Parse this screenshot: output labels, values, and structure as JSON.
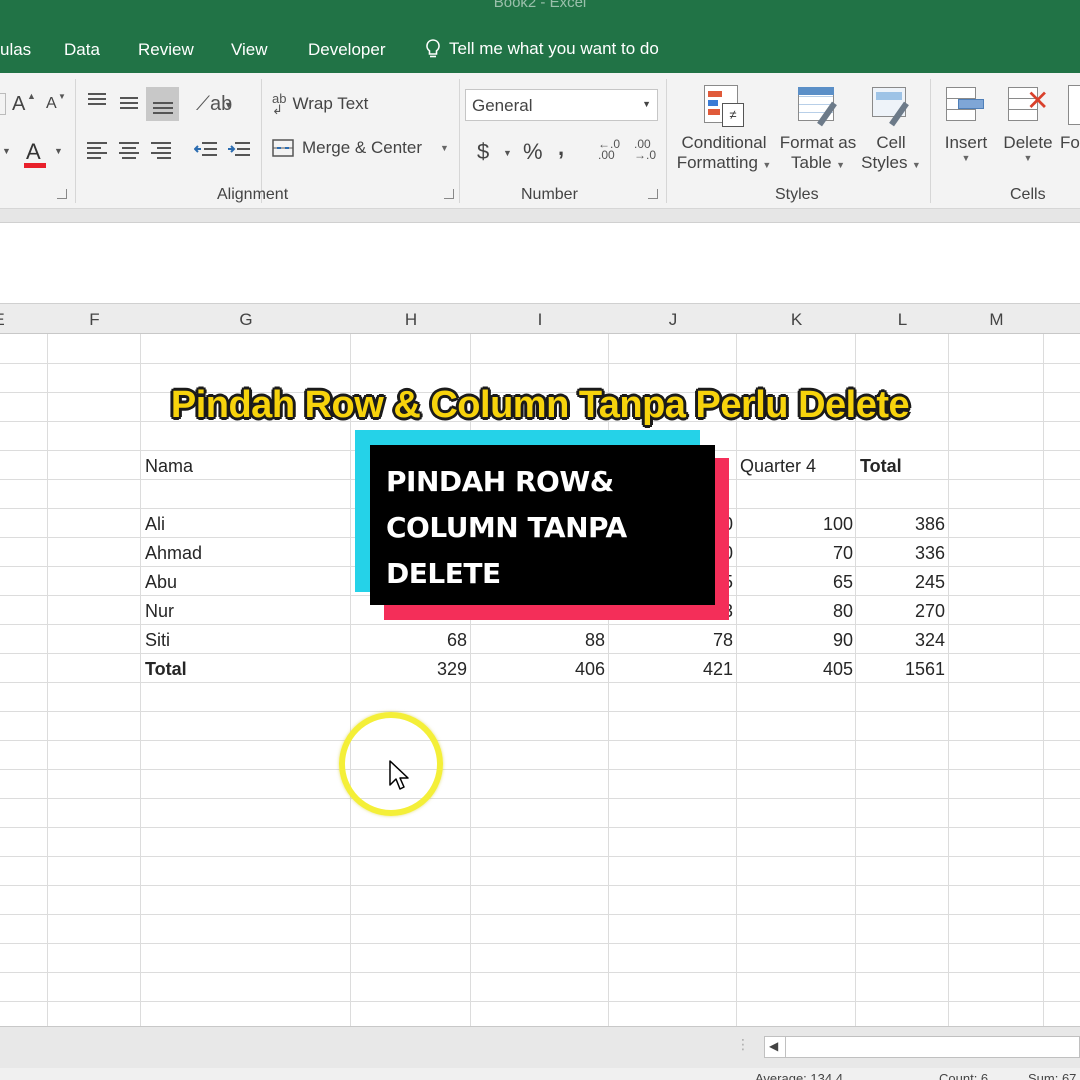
{
  "window": {
    "title": "Book2  -  Excel"
  },
  "menu": {
    "tabs": [
      "ulas",
      "Data",
      "Review",
      "View",
      "Developer"
    ],
    "tell_me": "Tell me what you want to do"
  },
  "ribbon": {
    "font_grow": "A",
    "font_shrink": "A",
    "font_color": "A",
    "wrap_text": "Wrap Text",
    "merge_center": "Merge & Center",
    "number_format": "General",
    "currency": "$",
    "percent": "%",
    "comma": ",",
    "conditional_formatting": [
      "Conditional",
      "Formatting"
    ],
    "format_as_table": [
      "Format as",
      "Table"
    ],
    "cell_styles": [
      "Cell",
      "Styles"
    ],
    "insert": "Insert",
    "delete": "Delete",
    "format_partial": "Fo",
    "groups": {
      "alignment": "Alignment",
      "number": "Number",
      "styles": "Styles",
      "cells": "Cells"
    }
  },
  "grid": {
    "columns": [
      "E",
      "F",
      "G",
      "H",
      "I",
      "J",
      "K",
      "L",
      "M"
    ],
    "header_row": {
      "name": "Nama",
      "quarter4": "Quarter 4",
      "total": "Total"
    },
    "rows": [
      {
        "name": "Ali",
        "h": "",
        "i": "",
        "j": "0",
        "k": "100",
        "l": "386"
      },
      {
        "name": "Ahmad",
        "h": "",
        "i": "",
        "j": "0",
        "k": "70",
        "l": "336"
      },
      {
        "name": "Abu",
        "h": "",
        "i": "",
        "j": "5",
        "k": "65",
        "l": "245"
      },
      {
        "name": "Nur",
        "h": "",
        "i": "",
        "j": "3",
        "k": "80",
        "l": "270"
      },
      {
        "name": "Siti",
        "h": "68",
        "i": "88",
        "j": "78",
        "k": "90",
        "l": "324"
      },
      {
        "name": "Total",
        "h": "329",
        "i": "406",
        "j": "421",
        "k": "405",
        "l": "1561"
      }
    ]
  },
  "status": {
    "average": "Average: 134.4",
    "count": "Count: 6",
    "sum": "Sum: 67"
  },
  "overlay": {
    "headline": "Pindah Row & Column Tanpa Perlu Delete",
    "card_lines": [
      "PINDAH ROW&",
      "COLUMN TANPA",
      "DELETE"
    ]
  },
  "colors": {
    "excel_green": "#217346",
    "headline_yellow": "#f7d30c",
    "card_cyan": "#25d2e8",
    "card_red": "#f42e59",
    "cursor_ring": "#f4ef38"
  }
}
